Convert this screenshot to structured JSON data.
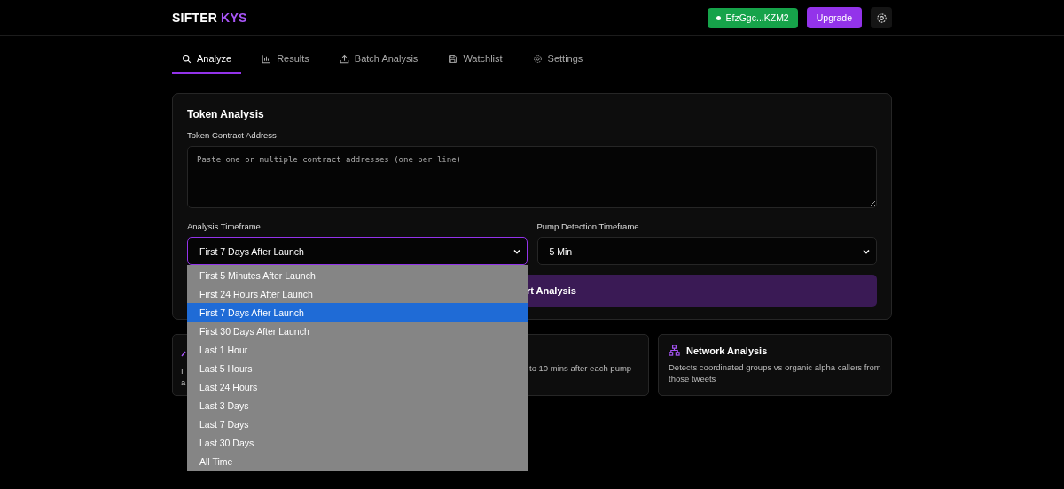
{
  "header": {
    "brand": "SIFTER",
    "brand_accent": "KYS",
    "wallet": "EfzGgc...KZM2",
    "upgrade": "Upgrade"
  },
  "tabs": [
    {
      "label": "Analyze",
      "selected": true
    },
    {
      "label": "Results",
      "selected": false
    },
    {
      "label": "Batch Analysis",
      "selected": false
    },
    {
      "label": "Watchlist",
      "selected": false
    },
    {
      "label": "Settings",
      "selected": false
    }
  ],
  "token_analysis": {
    "title": "Token Analysis",
    "address_label": "Token Contract Address",
    "address_placeholder": "Paste one or multiple contract addresses (one per line)",
    "analysis_timeframe": {
      "label": "Analysis Timeframe",
      "value": "First 7 Days After Launch",
      "expanded": true,
      "options": [
        {
          "label": "First 5 Minutes After Launch",
          "selected": false
        },
        {
          "label": "First 24 Hours After Launch",
          "selected": false
        },
        {
          "label": "First 7 Days After Launch",
          "selected": true
        },
        {
          "label": "First 30 Days After Launch",
          "selected": false
        },
        {
          "label": "Last 1 Hour",
          "selected": false
        },
        {
          "label": "Last 5 Hours",
          "selected": false
        },
        {
          "label": "Last 24 Hours",
          "selected": false
        },
        {
          "label": "Last 3 Days",
          "selected": false
        },
        {
          "label": "Last 7 Days",
          "selected": false
        },
        {
          "label": "Last 30 Days",
          "selected": false
        },
        {
          "label": "All Time",
          "selected": false
        }
      ]
    },
    "pump_timeframe": {
      "label": "Pump Detection Timeframe",
      "value": "5 Min"
    },
    "start_button": "rt Analysis"
  },
  "feature_cards": [
    {
      "kind": "partial-left",
      "lines": [
        "I",
        "a"
      ]
    },
    {
      "kind": "partial-right",
      "lines": [
        "to 10 mins after each pump"
      ]
    },
    {
      "kind": "full",
      "title": "Network Analysis",
      "lines": [
        "Detects coordinated groups vs organic alpha callers from those tweets"
      ]
    }
  ]
}
